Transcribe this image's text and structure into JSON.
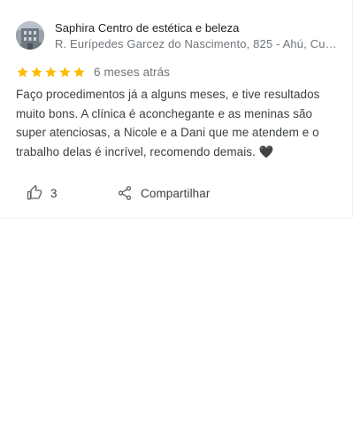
{
  "place": {
    "name": "Saphira Centro de estética e beleza",
    "address": "R. Eurípedes Garcez do Nascimento, 825 - Ahú, Cu…",
    "avatar_icon": "building-photo-icon"
  },
  "review": {
    "rating": 5,
    "rating_max": 5,
    "time": "6 meses atrás",
    "text": "Faço procedimentos já a alguns meses, e tive resultados muito bons. A clínica é aconchegante e as meninas são super atenciosas, a Nicole e a Dani que me atendem e o trabalho delas é incrível, recomendo demais. 🖤"
  },
  "actions": {
    "like_count": "3",
    "share_label": "Compartilhar",
    "like_icon": "thumbs-up-icon",
    "share_icon": "share-icon"
  },
  "colors": {
    "star": "#fbbc04",
    "primary_text": "#202124",
    "secondary_text": "#70757a",
    "body_text": "#3c4043"
  }
}
